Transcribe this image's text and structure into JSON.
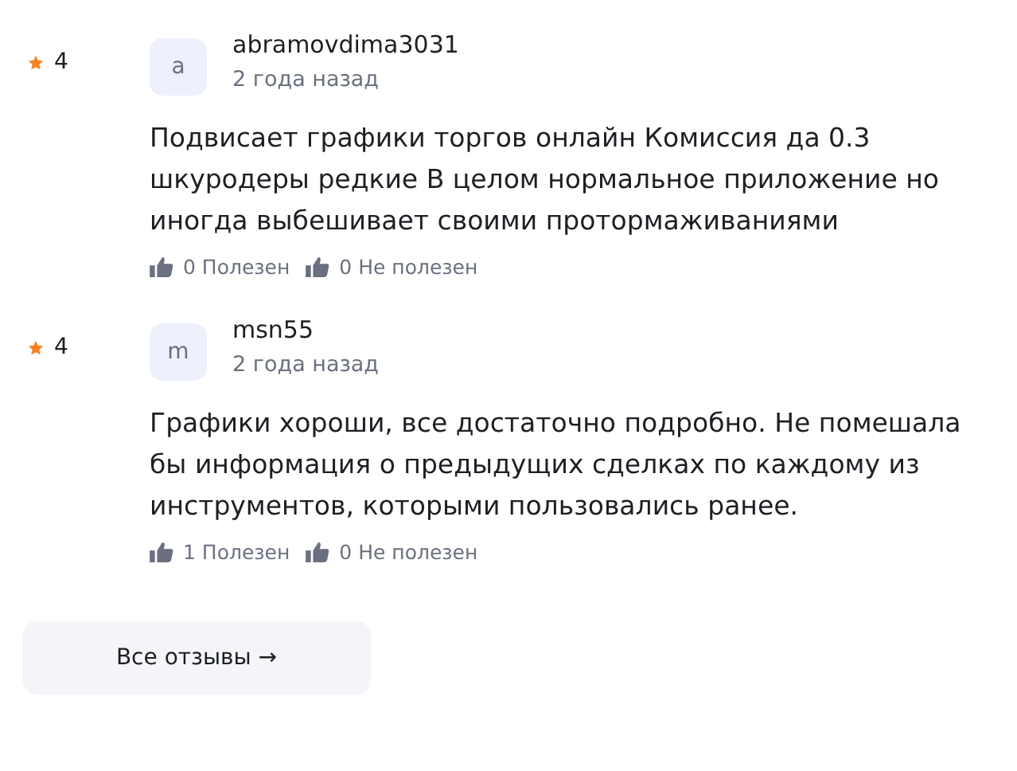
{
  "reviews": [
    {
      "rating": "4",
      "avatar": "a",
      "author": "abramovdima3031",
      "date": "2 года назад",
      "text": "Подвисает графики торгов онлайн Комиссия да 0.3 шкуродеры редкие В целом нормальное приложение но иногда выбешивает своими протормаживаниями",
      "helpful": "0 Полезен",
      "not_helpful": "0 Не полезен"
    },
    {
      "rating": "4",
      "avatar": "m",
      "author": "msn55",
      "date": "2 года назад",
      "text": "Графики хороши, все достаточно подробно. Не помешала бы информация о предыдущих сделках по каждому из инструментов, которыми пользовались ранее.",
      "helpful": "1 Полезен",
      "not_helpful": "0 Не полезен"
    }
  ],
  "all_reviews_button": "Все отзывы →"
}
